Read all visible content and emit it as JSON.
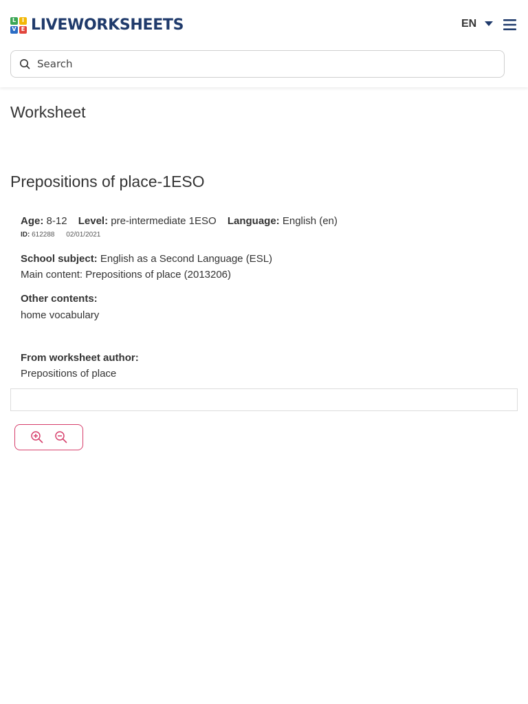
{
  "header": {
    "logo": {
      "letters": [
        "L",
        "I",
        "V",
        "E"
      ],
      "text": "LIVEWORKSHEETS",
      "colors": [
        "#3aa655",
        "#f2b705",
        "#2b6cc4",
        "#e2453c"
      ]
    },
    "language": "EN",
    "search_placeholder": "Search"
  },
  "page_title": "Worksheet",
  "worksheet": {
    "title": "Prepositions of place-1ESO",
    "age_label": "Age:",
    "age": "8-12",
    "level_label": "Level:",
    "level": "pre-intermediate 1ESO",
    "language_label": "Language:",
    "language": "English (en)",
    "id_label": "ID:",
    "id": "612288",
    "date": "02/01/2021",
    "subject_label": "School subject:",
    "subject": "English as a Second Language (ESL)",
    "main_content": "Main content: Prepositions of place (2013206)",
    "other_label": "Other contents:",
    "other": "home vocabulary",
    "author_label": "From worksheet author:",
    "author_note": "Prepositions of place"
  },
  "colors": {
    "brand": "#1f3a6b",
    "accent": "#d63d6a"
  },
  "icons": {
    "search": "search-icon",
    "dropdown": "caret-down-icon",
    "menu": "hamburger-menu-icon",
    "zoom_in": "zoom-in-icon",
    "zoom_out": "zoom-out-icon"
  }
}
